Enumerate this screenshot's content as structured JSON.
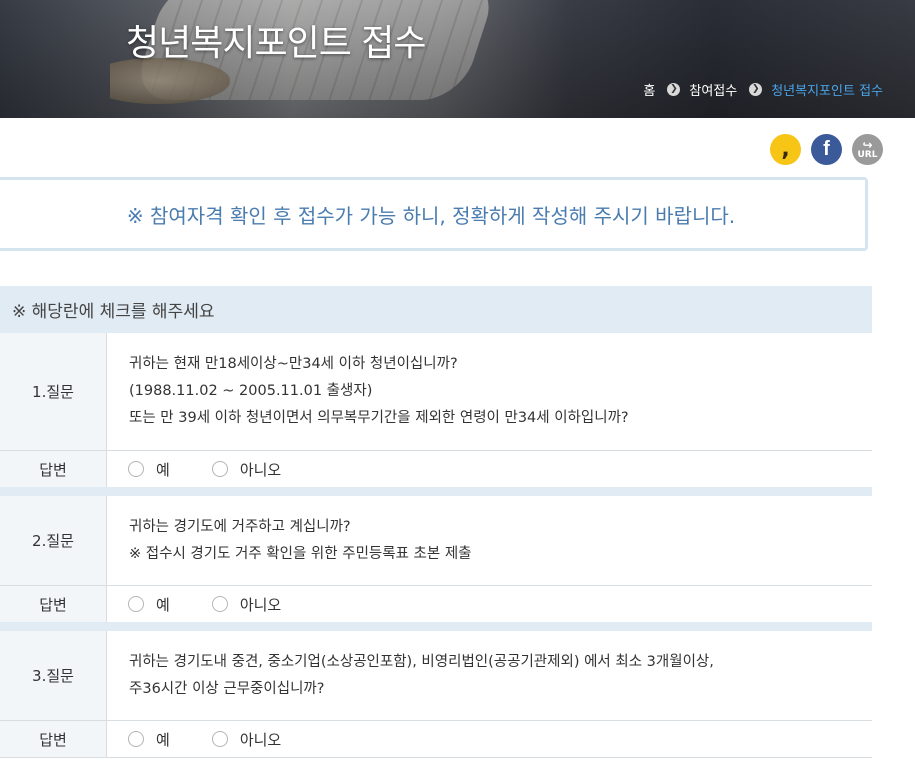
{
  "header": {
    "title": "청년복지포인트 접수",
    "breadcrumb": [
      "홈",
      "참여접수",
      "청년복지포인트 접수"
    ],
    "breadcrumb_sep_icon": "chevron-right-icon"
  },
  "share": {
    "kakao_icon": "kakaostory-icon",
    "facebook_icon": "facebook-icon",
    "url_label": "URL"
  },
  "notice": "※ 참여자격 확인 후 접수가 가능 하니, 정확하게 작성해 주시기 바랍니다.",
  "section_title": "※ 해당란에 체크를 해주세요",
  "answer_label": "답변",
  "options": [
    "예",
    "아니오"
  ],
  "questions": [
    {
      "label": "1.질문",
      "lines": [
        "귀하는 현재 만18세이상~만34세 이하 청년이십니까?",
        "(1988.11.02 ~ 2005.11.01 출생자)",
        "또는 만 39세 이하 청년이면서 의무복무기간을 제외한 연령이 만34세 이하입니까?"
      ]
    },
    {
      "label": "2.질문",
      "lines": [
        "귀하는 경기도에 거주하고 계십니까?",
        "※ 접수시 경기도 거주 확인을 위한 주민등록표 초본 제출"
      ]
    },
    {
      "label": "3.질문",
      "lines": [
        "귀하는 경기도내 중견, 중소기업(소상공인포함), 비영리법인(공공기관제외) 에서 최소 3개월이상,",
        "주36시간 이상 근무중이십니까?"
      ]
    }
  ],
  "colors": {
    "accent": "#4aa3e6",
    "notice_text": "#4a7cb0",
    "section_bg": "#e0ebf4"
  }
}
